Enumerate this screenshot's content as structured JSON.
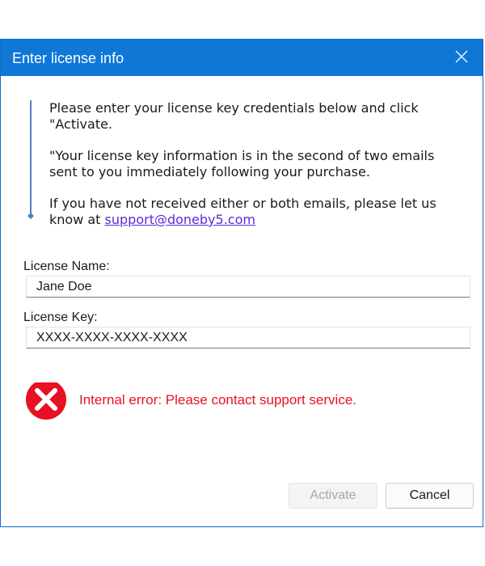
{
  "window": {
    "title": "Enter license info",
    "close_icon": "close-icon"
  },
  "info": {
    "paragraph1": "Please enter your license key credentials below and click \"Activate.",
    "paragraph2": "\"Your license key information is in the second of two emails sent to you immediately following your purchase.",
    "paragraph3_prefix": "If you have not received either or both emails, please let us know at ",
    "support_link": "support@doneby5.com"
  },
  "form": {
    "name_label": "License Name:",
    "name_value": "Jane Doe",
    "key_label": "License Key:",
    "key_value": "XXXX-XXXX-XXXX-XXXX"
  },
  "error": {
    "icon": "error-circle-icon",
    "message": "Internal error: Please contact support service."
  },
  "buttons": {
    "activate_label": "Activate",
    "activate_enabled": false,
    "cancel_label": "Cancel"
  },
  "colors": {
    "titlebar": "#0f78d7",
    "error": "#e81123",
    "link": "#5b2bdb"
  }
}
